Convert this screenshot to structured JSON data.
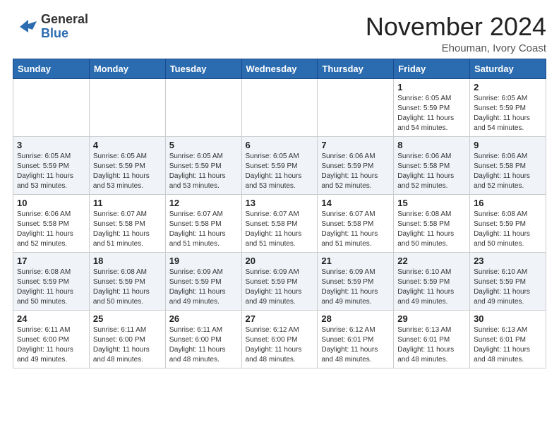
{
  "header": {
    "logo_general": "General",
    "logo_blue": "Blue",
    "month_title": "November 2024",
    "location": "Ehouman, Ivory Coast"
  },
  "weekdays": [
    "Sunday",
    "Monday",
    "Tuesday",
    "Wednesday",
    "Thursday",
    "Friday",
    "Saturday"
  ],
  "weeks": [
    [
      {
        "day": "",
        "info": ""
      },
      {
        "day": "",
        "info": ""
      },
      {
        "day": "",
        "info": ""
      },
      {
        "day": "",
        "info": ""
      },
      {
        "day": "",
        "info": ""
      },
      {
        "day": "1",
        "info": "Sunrise: 6:05 AM\nSunset: 5:59 PM\nDaylight: 11 hours and 54 minutes."
      },
      {
        "day": "2",
        "info": "Sunrise: 6:05 AM\nSunset: 5:59 PM\nDaylight: 11 hours and 54 minutes."
      }
    ],
    [
      {
        "day": "3",
        "info": "Sunrise: 6:05 AM\nSunset: 5:59 PM\nDaylight: 11 hours and 53 minutes."
      },
      {
        "day": "4",
        "info": "Sunrise: 6:05 AM\nSunset: 5:59 PM\nDaylight: 11 hours and 53 minutes."
      },
      {
        "day": "5",
        "info": "Sunrise: 6:05 AM\nSunset: 5:59 PM\nDaylight: 11 hours and 53 minutes."
      },
      {
        "day": "6",
        "info": "Sunrise: 6:05 AM\nSunset: 5:59 PM\nDaylight: 11 hours and 53 minutes."
      },
      {
        "day": "7",
        "info": "Sunrise: 6:06 AM\nSunset: 5:59 PM\nDaylight: 11 hours and 52 minutes."
      },
      {
        "day": "8",
        "info": "Sunrise: 6:06 AM\nSunset: 5:58 PM\nDaylight: 11 hours and 52 minutes."
      },
      {
        "day": "9",
        "info": "Sunrise: 6:06 AM\nSunset: 5:58 PM\nDaylight: 11 hours and 52 minutes."
      }
    ],
    [
      {
        "day": "10",
        "info": "Sunrise: 6:06 AM\nSunset: 5:58 PM\nDaylight: 11 hours and 52 minutes."
      },
      {
        "day": "11",
        "info": "Sunrise: 6:07 AM\nSunset: 5:58 PM\nDaylight: 11 hours and 51 minutes."
      },
      {
        "day": "12",
        "info": "Sunrise: 6:07 AM\nSunset: 5:58 PM\nDaylight: 11 hours and 51 minutes."
      },
      {
        "day": "13",
        "info": "Sunrise: 6:07 AM\nSunset: 5:58 PM\nDaylight: 11 hours and 51 minutes."
      },
      {
        "day": "14",
        "info": "Sunrise: 6:07 AM\nSunset: 5:58 PM\nDaylight: 11 hours and 51 minutes."
      },
      {
        "day": "15",
        "info": "Sunrise: 6:08 AM\nSunset: 5:58 PM\nDaylight: 11 hours and 50 minutes."
      },
      {
        "day": "16",
        "info": "Sunrise: 6:08 AM\nSunset: 5:59 PM\nDaylight: 11 hours and 50 minutes."
      }
    ],
    [
      {
        "day": "17",
        "info": "Sunrise: 6:08 AM\nSunset: 5:59 PM\nDaylight: 11 hours and 50 minutes."
      },
      {
        "day": "18",
        "info": "Sunrise: 6:08 AM\nSunset: 5:59 PM\nDaylight: 11 hours and 50 minutes."
      },
      {
        "day": "19",
        "info": "Sunrise: 6:09 AM\nSunset: 5:59 PM\nDaylight: 11 hours and 49 minutes."
      },
      {
        "day": "20",
        "info": "Sunrise: 6:09 AM\nSunset: 5:59 PM\nDaylight: 11 hours and 49 minutes."
      },
      {
        "day": "21",
        "info": "Sunrise: 6:09 AM\nSunset: 5:59 PM\nDaylight: 11 hours and 49 minutes."
      },
      {
        "day": "22",
        "info": "Sunrise: 6:10 AM\nSunset: 5:59 PM\nDaylight: 11 hours and 49 minutes."
      },
      {
        "day": "23",
        "info": "Sunrise: 6:10 AM\nSunset: 5:59 PM\nDaylight: 11 hours and 49 minutes."
      }
    ],
    [
      {
        "day": "24",
        "info": "Sunrise: 6:11 AM\nSunset: 6:00 PM\nDaylight: 11 hours and 49 minutes."
      },
      {
        "day": "25",
        "info": "Sunrise: 6:11 AM\nSunset: 6:00 PM\nDaylight: 11 hours and 48 minutes."
      },
      {
        "day": "26",
        "info": "Sunrise: 6:11 AM\nSunset: 6:00 PM\nDaylight: 11 hours and 48 minutes."
      },
      {
        "day": "27",
        "info": "Sunrise: 6:12 AM\nSunset: 6:00 PM\nDaylight: 11 hours and 48 minutes."
      },
      {
        "day": "28",
        "info": "Sunrise: 6:12 AM\nSunset: 6:01 PM\nDaylight: 11 hours and 48 minutes."
      },
      {
        "day": "29",
        "info": "Sunrise: 6:13 AM\nSunset: 6:01 PM\nDaylight: 11 hours and 48 minutes."
      },
      {
        "day": "30",
        "info": "Sunrise: 6:13 AM\nSunset: 6:01 PM\nDaylight: 11 hours and 48 minutes."
      }
    ]
  ]
}
